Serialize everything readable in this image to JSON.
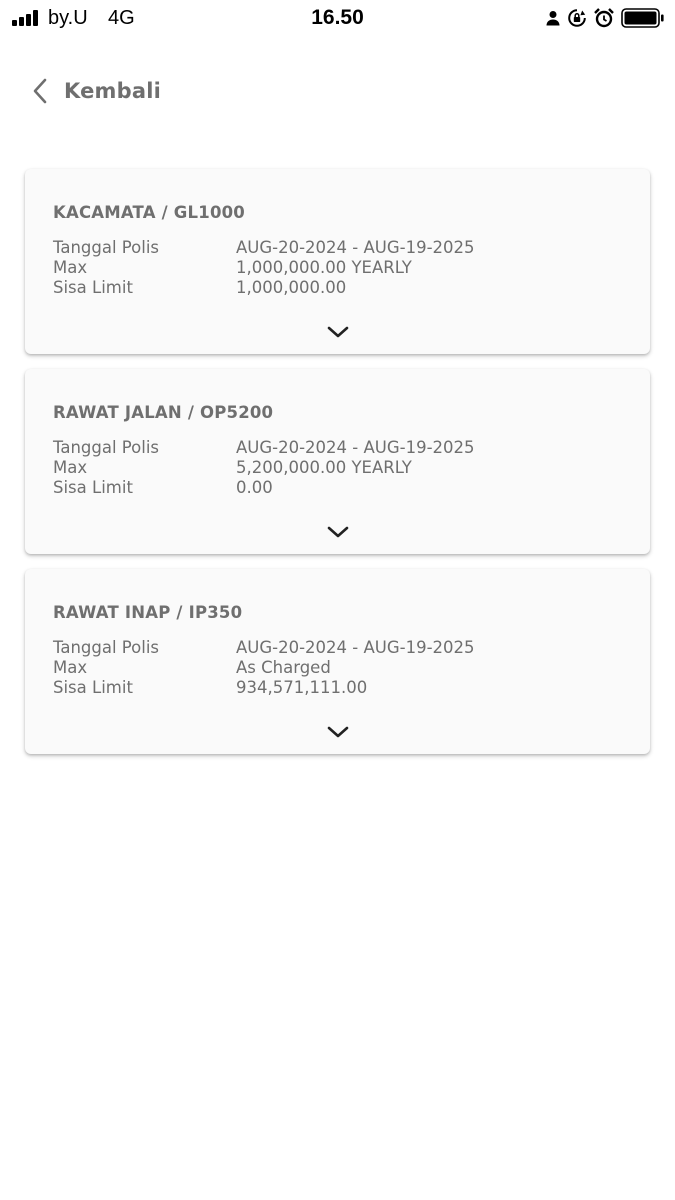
{
  "status_bar": {
    "carrier": "by.U",
    "network": "4G",
    "time": "16.50",
    "icons": [
      "signal-bars-icon",
      "person-icon",
      "rotation-lock-icon",
      "alarm-icon",
      "battery-icon"
    ]
  },
  "nav": {
    "back_label": "Kembali",
    "back_icon": "chevron-left-icon"
  },
  "colors": {
    "text": "#6f6f6f",
    "card_background": "#fafafa",
    "icon": "#222222"
  },
  "cards": [
    {
      "title": "KACAMATA / GL1000",
      "rows": [
        {
          "label": "Tanggal Polis",
          "value": "AUG-20-2024 - AUG-19-2025"
        },
        {
          "label": "Max",
          "value": "1,000,000.00 YEARLY"
        },
        {
          "label": "Sisa Limit",
          "value": "1,000,000.00"
        }
      ],
      "expand_icon": "chevron-down-icon"
    },
    {
      "title": "RAWAT JALAN / OP5200",
      "rows": [
        {
          "label": "Tanggal Polis",
          "value": "AUG-20-2024 - AUG-19-2025"
        },
        {
          "label": "Max",
          "value": "5,200,000.00 YEARLY"
        },
        {
          "label": "Sisa Limit",
          "value": "0.00"
        }
      ],
      "expand_icon": "chevron-down-icon"
    },
    {
      "title": "RAWAT INAP / IP350",
      "rows": [
        {
          "label": "Tanggal Polis",
          "value": "AUG-20-2024 - AUG-19-2025"
        },
        {
          "label": "Max",
          "value": "As Charged"
        },
        {
          "label": "Sisa Limit",
          "value": "934,571,111.00"
        }
      ],
      "expand_icon": "chevron-down-icon"
    }
  ]
}
